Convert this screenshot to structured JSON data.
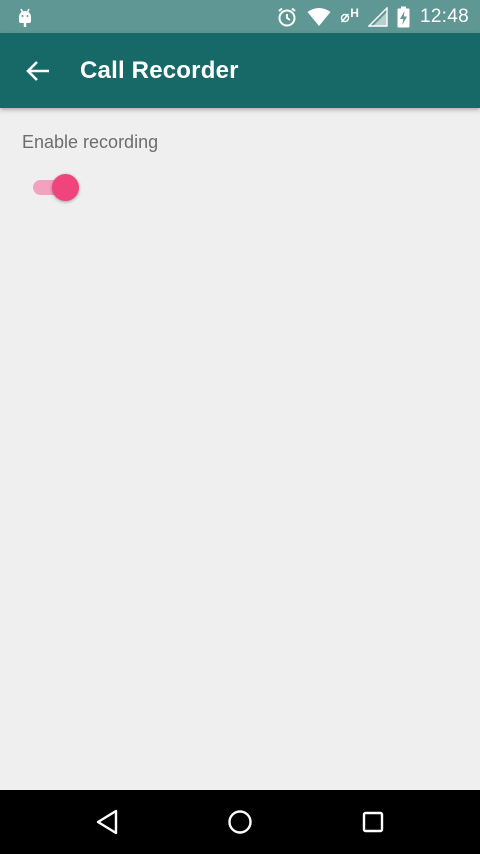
{
  "status_bar": {
    "time": "12:48",
    "network_label": "H",
    "icons": [
      "android-debug-icon",
      "alarm-icon",
      "wifi-icon",
      "no-sim-h-icon",
      "signal-icon",
      "battery-charging-icon"
    ],
    "background_color": "#5e9793"
  },
  "app_bar": {
    "title": "Call Recorder",
    "back_icon": "arrow-back-icon",
    "background_color": "#166966"
  },
  "settings": {
    "enable_recording": {
      "label": "Enable recording",
      "state": "on",
      "accent_color": "#f0447c"
    }
  },
  "nav_bar": {
    "buttons": [
      "back-triangle-icon",
      "home-circle-icon",
      "recents-square-icon"
    ]
  }
}
